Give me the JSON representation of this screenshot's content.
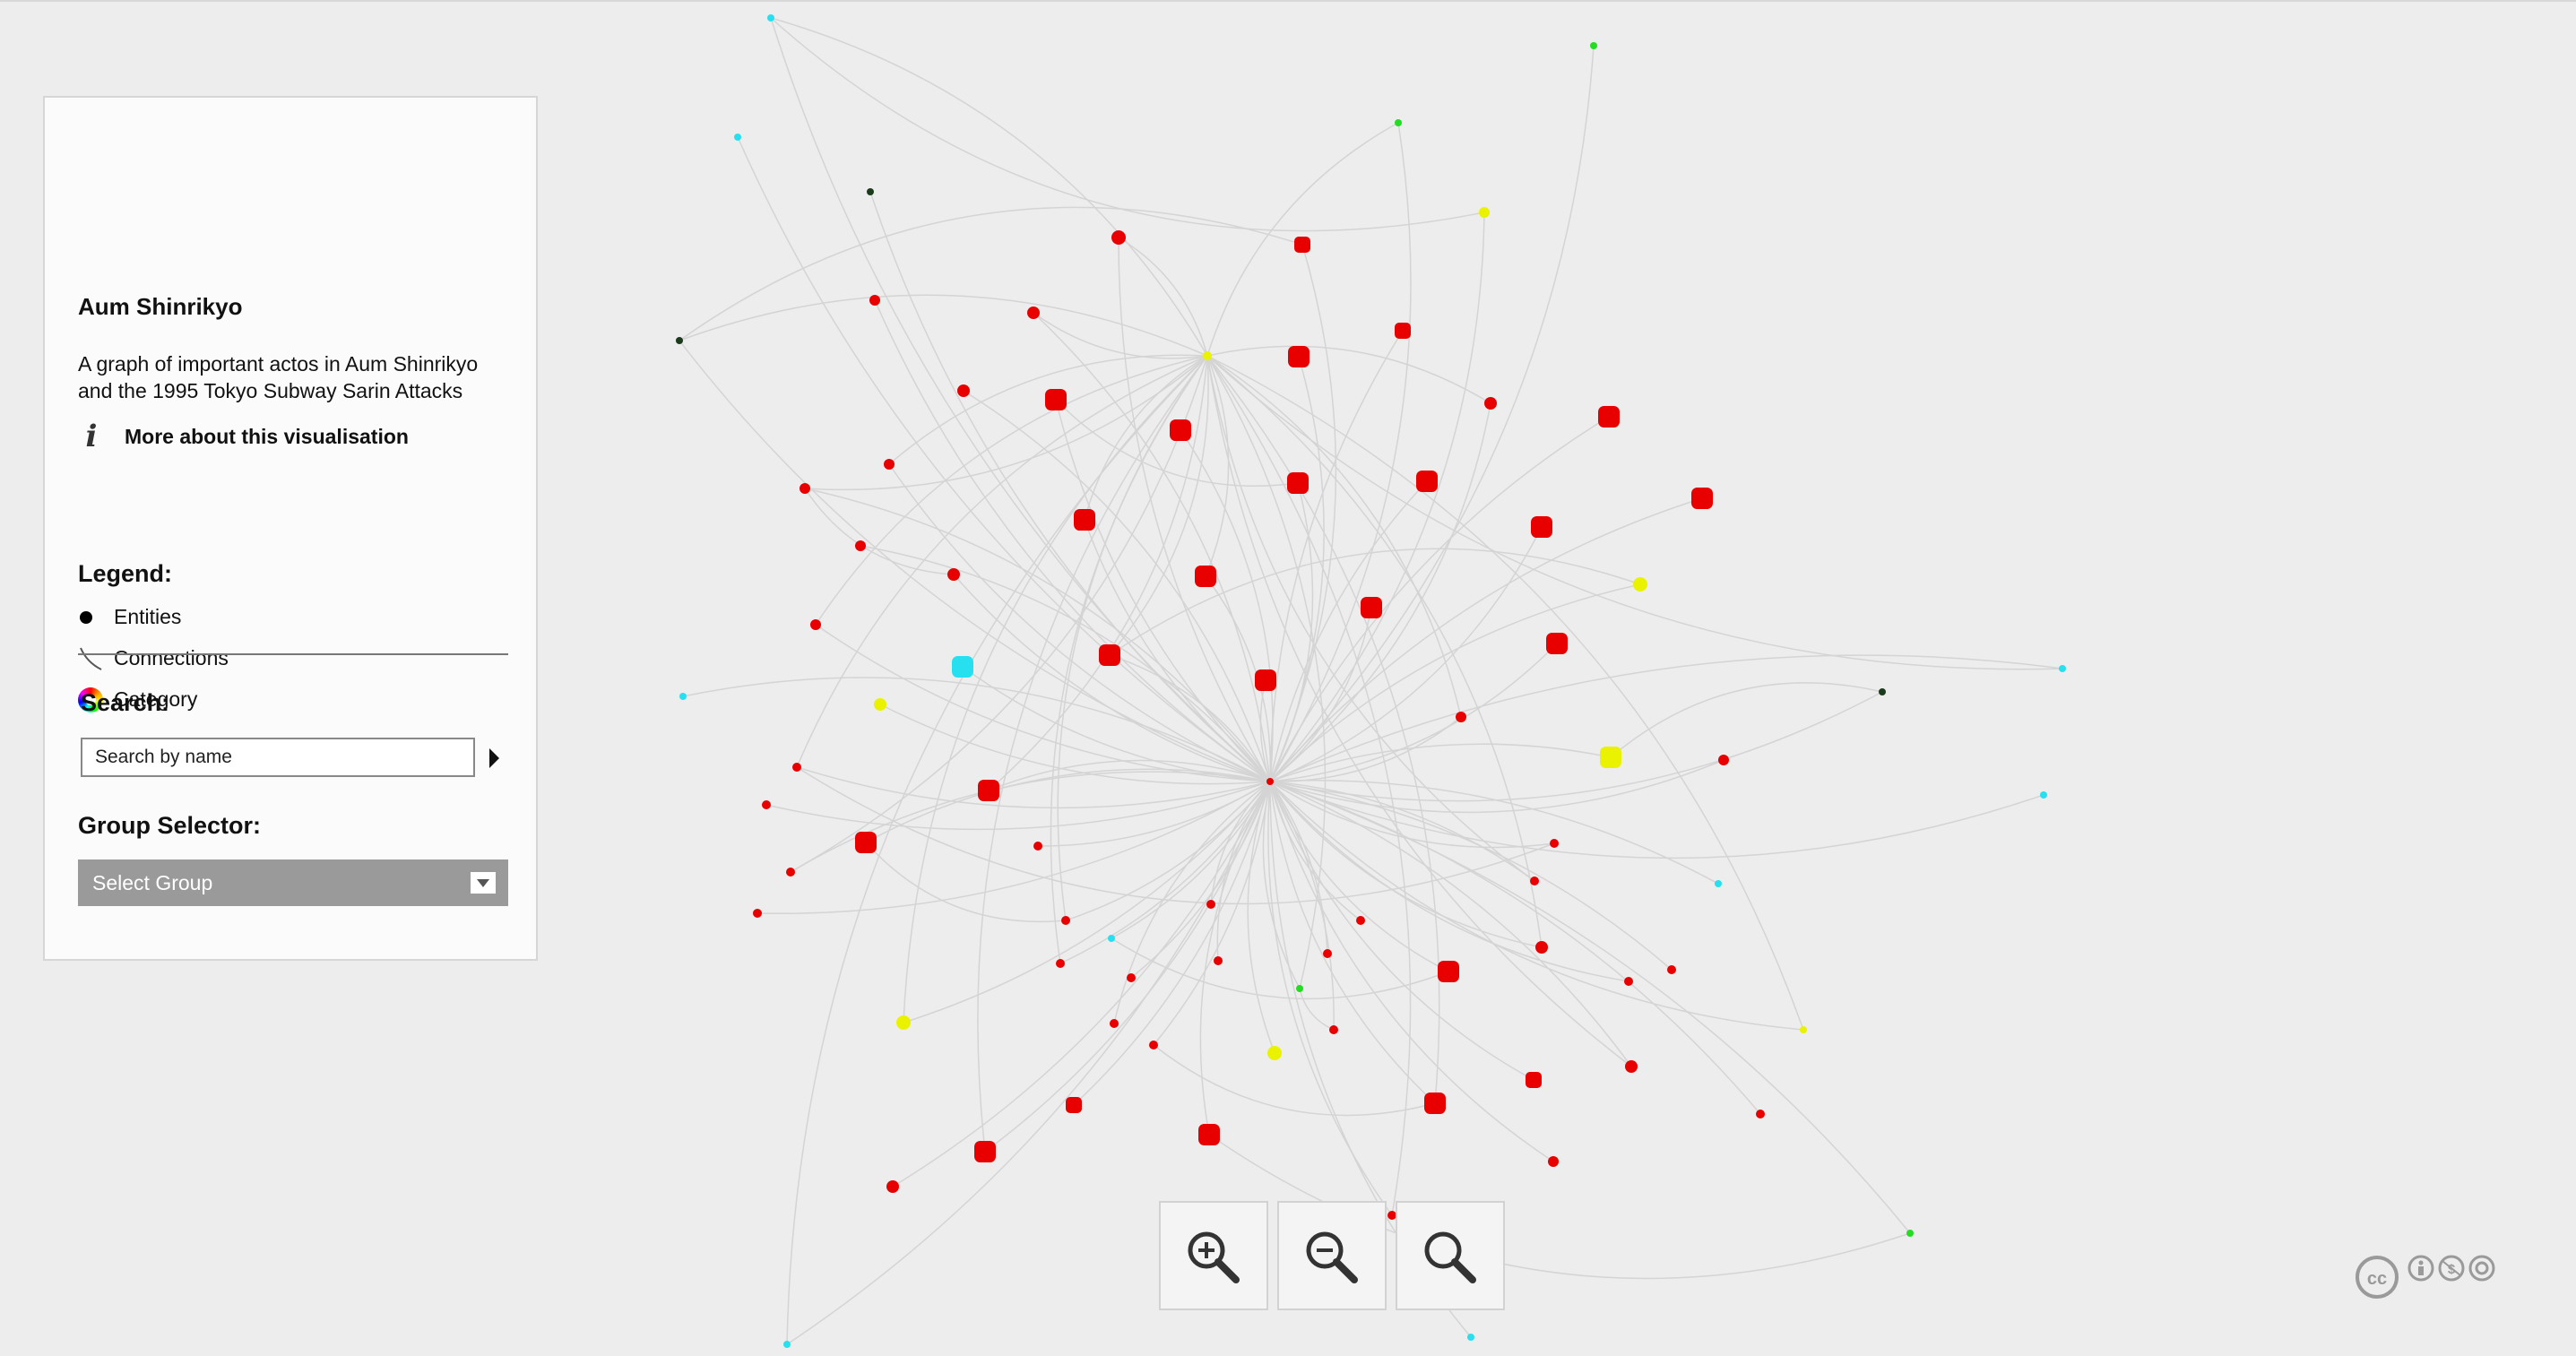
{
  "panel": {
    "title": "Aum Shinrikyo",
    "description": "A graph of important actos in Aum Shinrikyo and the 1995 Tokyo Subway Sarin Attacks",
    "more_link": "More about this visualisation",
    "legend_title": "Legend:",
    "legend": [
      {
        "label": "Entities",
        "icon": "entity-dot-icon"
      },
      {
        "label": "Connections",
        "icon": "connection-line-icon"
      },
      {
        "label": "Category",
        "icon": "color-wheel-icon"
      }
    ],
    "search_title": "Search:",
    "search_placeholder": "Search by name",
    "group_title": "Group Selector:",
    "group_select_value": "Select Group"
  },
  "zoom": {
    "buttons": [
      {
        "name": "zoom-in-button",
        "icon": "zoom-in-icon"
      },
      {
        "name": "zoom-out-button",
        "icon": "zoom-out-icon"
      },
      {
        "name": "zoom-reset-button",
        "icon": "magnifier-icon"
      }
    ]
  },
  "colors": {
    "background": "#ededed",
    "red": "#e80000",
    "cyan": "#26e0f0",
    "yellow": "#eaf200",
    "green": "#22dd22",
    "dark": "#1c3a1c",
    "edge": "#d4d4d4",
    "panel_bg": "#fbfbfb",
    "select_bg": "#9a9a9a"
  },
  "license_icons": [
    "cc-icon",
    "by-icon",
    "nc-icon",
    "sa-icon"
  ]
}
